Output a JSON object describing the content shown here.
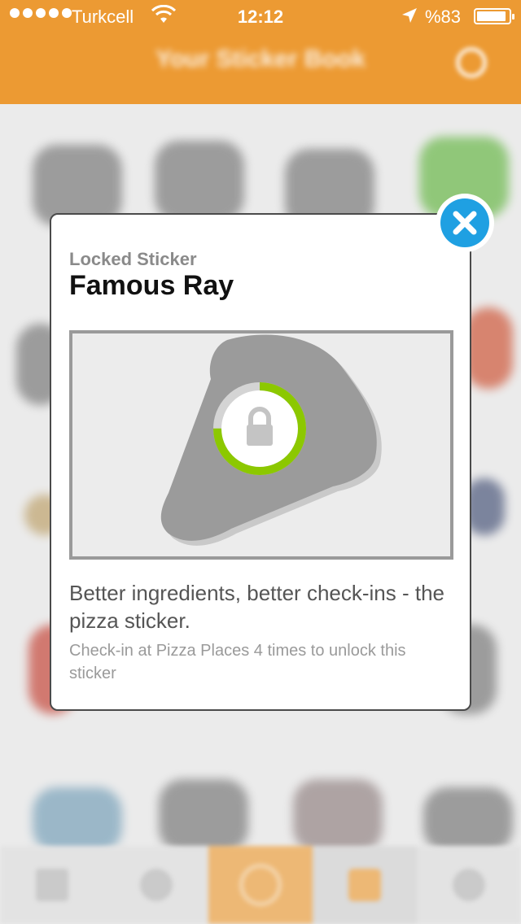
{
  "status_bar": {
    "carrier": "Turkcell",
    "time": "12:12",
    "battery": "%83",
    "battery_level": 0.83
  },
  "header": {
    "title": "Your Sticker Book"
  },
  "modal": {
    "subtitle": "Locked Sticker",
    "title": "Famous Ray",
    "description": "Better ingredients, better check-ins - the pizza sticker.",
    "hint": "Check-in at Pizza Places 4 times to unlock this sticker",
    "progress": 0.75
  },
  "colors": {
    "brand_orange": "#ec9a33",
    "close_blue": "#1fa0e2",
    "progress_green": "#8cc800"
  },
  "tab_bar": {
    "icons": [
      "grid-icon",
      "globe-icon",
      "checkin-icon",
      "sticker-book-icon",
      "profile-icon"
    ],
    "active_index": 2
  }
}
